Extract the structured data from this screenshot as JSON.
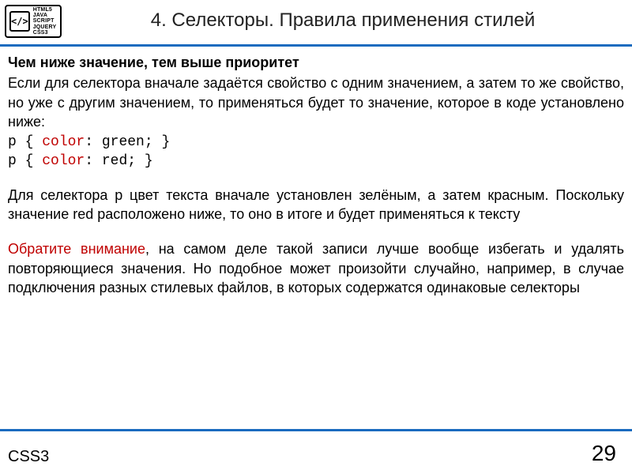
{
  "badge": {
    "icon_text": "</>",
    "lines": [
      "HTML5",
      "JAVA SCRIPT",
      "JQUERY",
      "CSS3"
    ]
  },
  "title": "4. Селекторы. Правила применения стилей",
  "content": {
    "subheading": "Чем ниже значение, тем выше приоритет",
    "para1": "Если для селектора вначале задаётся свойство с одним значением, а затем то же свойство, но уже с другим значением, то применяться будет то значение, которое в коде установлено ниже:",
    "code": {
      "line1_pre": "p { ",
      "line1_prop": "color",
      "line1_post": ": green; }",
      "line2_pre": "p { ",
      "line2_prop": "color",
      "line2_post": ": red; }"
    },
    "para2": "Для селектора p цвет текста вначале установлен зелёным, а затем красным. Поскольку значение red расположено ниже, то оно в итоге и будет применяться к тексту",
    "note_bold": "Обратите внимание",
    "note_rest": ", на самом деле такой записи лучше вообще избегать и удалять повторяющиеся значения. Но подобное может произойти случайно, например, в случае подключения разных стилевых файлов, в которых содержатся одинаковые селекторы"
  },
  "footer": {
    "left": "CSS3",
    "page": "29"
  }
}
